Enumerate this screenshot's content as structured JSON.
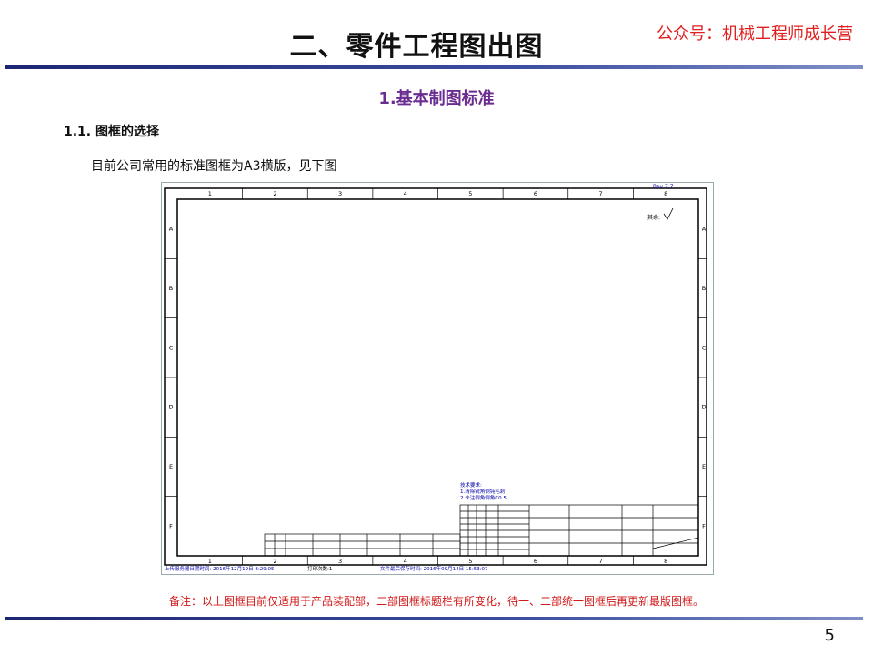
{
  "slide": {
    "title": "二、零件工程图出图",
    "brand": "公众号：机械工程师成长营",
    "section_title": "1.基本制图标准",
    "subsection": "1.1. 图框的选择",
    "description": "目前公司常用的标准图框为A3横版，见下图",
    "note": "备注：以上图框目前仅适用于产品装配部，二部图框标题栏有所变化，待一、二部统一图框后再更新最版图框。",
    "page_number": "5"
  },
  "drawing": {
    "col_labels": [
      "1",
      "2",
      "3",
      "4",
      "5",
      "6",
      "7",
      "8"
    ],
    "row_labels": [
      "A",
      "B",
      "C",
      "D",
      "E",
      "F"
    ],
    "revision": "Rev 7.7",
    "surface_mark": "其余:",
    "tech_requirements": [
      "技术要求:",
      "1.清除锐角倒钝毛刺",
      "2.未注倒角倒角C0.5"
    ],
    "footer_left": "上传服务器日期时间: 2016年12月19日 8:29:05",
    "footer_mid": "打印次数:1",
    "footer_right": "文件最后保存时间: 2016年09月14日 15:53:07"
  }
}
